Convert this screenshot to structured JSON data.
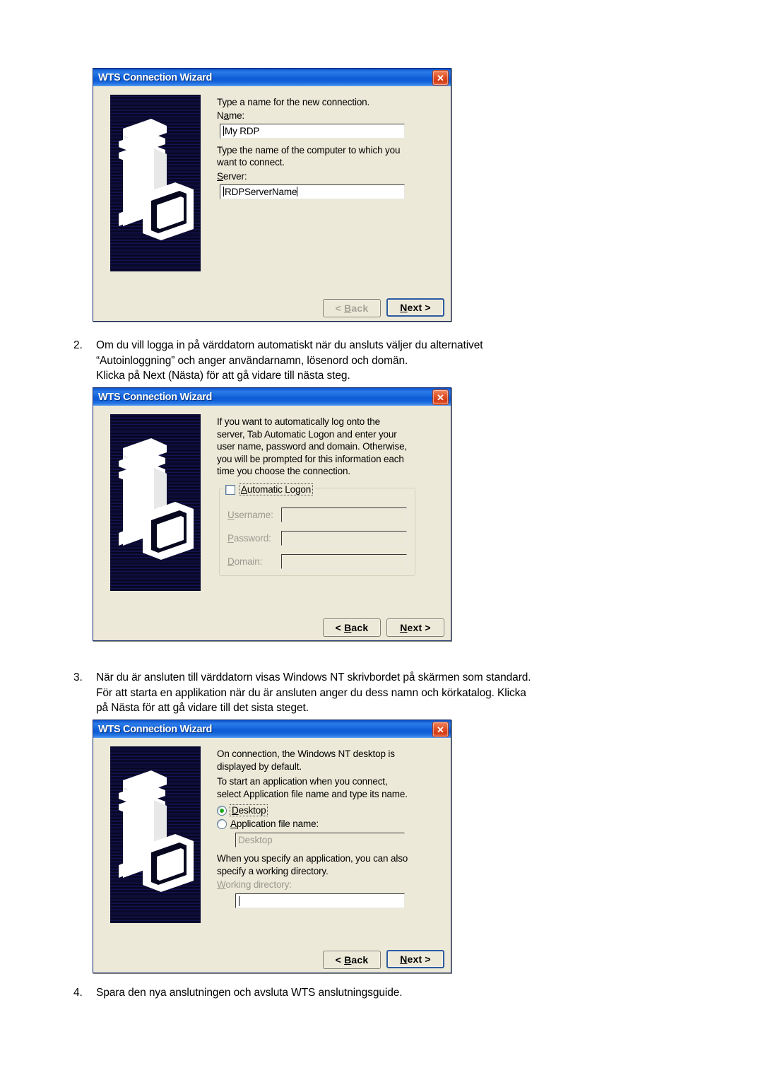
{
  "document": {
    "paragraphs": [
      {
        "number": "2.",
        "lines": [
          "Om du vill logga in på värddatorn automatiskt när du ansluts väljer du alternativet",
          "“Autoinloggning” och anger användarnamn, lösenord och domän.",
          "Klicka på Next (Nästa) för att gå vidare till nästa steg."
        ]
      },
      {
        "number": "3.",
        "lines": [
          "När du är ansluten till värddatorn visas Windows NT skrivbordet på skärmen som standard.",
          "För att starta en applikation när du är ansluten anger du dess namn och körkatalog. Klicka",
          "på Nästa för att gå vidare till det sista steget."
        ]
      },
      {
        "number": "4.",
        "lines": [
          "Spara den nya anslutningen och avsluta WTS anslutningsguide."
        ]
      }
    ]
  },
  "colors": {
    "title_gradient_start": "#0a51c8",
    "title_gradient_end": "#5b9ef2",
    "close_button": "#e4552a",
    "dialog_face": "#ece9d8",
    "banner_background": "#07071f",
    "radio_selected_dot": "#1fa81f",
    "default_button_border": "#2c5a9e"
  },
  "dialog1": {
    "title": "WTS Connection Wizard",
    "close_icon": "✕",
    "intro": [
      "Type a name for the new connection."
    ],
    "name_label_pre": "N",
    "name_label_accel": "a",
    "name_label_post": "me:",
    "name_value": "My RDP",
    "server_intro": [
      "Type the name of the computer to which you",
      "want to connect."
    ],
    "server_label_accel": "S",
    "server_label_post": "erver:",
    "server_value": "RDPServerName",
    "back_button": "< Back",
    "back_accel": "B",
    "next_button": "Next >",
    "next_accel": "N",
    "back_enabled": false,
    "next_default": true
  },
  "dialog2": {
    "title": "WTS Connection Wizard",
    "close_icon": "✕",
    "intro": [
      "If you want to automatically log onto the",
      "server, Tab Automatic Logon and enter your",
      "user name, password and domain. Otherwise,",
      "you will be prompted for this information each",
      "time you choose the connection."
    ],
    "checkbox_label_accel": "A",
    "checkbox_label_post": "utomatic Logon",
    "checkbox_checked": false,
    "fields": [
      {
        "accel": "U",
        "label_post": "sername:",
        "value": "",
        "enabled": false
      },
      {
        "accel": "P",
        "label_post": "assword:",
        "value": "",
        "enabled": false
      },
      {
        "accel": "D",
        "label_post": "omain:",
        "value": "",
        "enabled": false
      }
    ],
    "back_button": "< Back",
    "back_accel": "B",
    "next_button": "Next >",
    "next_accel": "N",
    "back_enabled": true,
    "next_default": false
  },
  "dialog3": {
    "title": "WTS Connection Wizard",
    "close_icon": "✕",
    "intro": [
      "On connection, the Windows NT desktop is",
      "displayed by default."
    ],
    "intro2": [
      "To start an application when you connect,",
      "select Application file name and type its name."
    ],
    "radio_desktop_accel": "D",
    "radio_desktop_post": "esktop",
    "radio_desktop_selected": true,
    "radio_app_accel": "A",
    "radio_app_post": "pplication file name:",
    "radio_app_selected": false,
    "app_file_value": "Desktop",
    "app_file_enabled": false,
    "note": [
      "When you specify an application, you can also",
      "specify a working directory."
    ],
    "workdir_accel": "W",
    "workdir_post": "orking directory:",
    "workdir_value": "",
    "back_button": "< Back",
    "back_accel": "B",
    "next_button": "Next >",
    "next_accel": "N",
    "back_enabled": true,
    "next_default": true
  }
}
